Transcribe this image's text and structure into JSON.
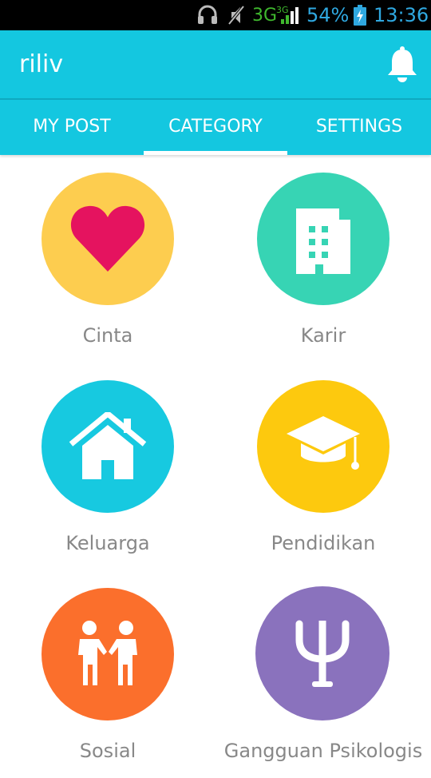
{
  "status_bar": {
    "network": "3G",
    "network_small": "3G",
    "battery_percent": "54%",
    "time": "13:36"
  },
  "app_bar": {
    "title": "riliv",
    "notification_icon": "bell-icon"
  },
  "tabs": [
    {
      "label": "MY POST",
      "active": false
    },
    {
      "label": "CATEGORY",
      "active": true
    },
    {
      "label": "SETTINGS",
      "active": false
    }
  ],
  "categories": [
    {
      "label": "Cinta",
      "icon": "heart-icon",
      "color": "#fdcd4f",
      "icon_color": "#e5135f"
    },
    {
      "label": "Karir",
      "icon": "building-icon",
      "color": "#37d4b4",
      "icon_color": "#ffffff"
    },
    {
      "label": "Keluarga",
      "icon": "house-icon",
      "color": "#17c9e0",
      "icon_color": "#ffffff"
    },
    {
      "label": "Pendidikan",
      "icon": "graduation-cap-icon",
      "color": "#fdc90e",
      "icon_color": "#ffffff"
    },
    {
      "label": "Sosial",
      "icon": "handshake-people-icon",
      "color": "#fb6f2c",
      "icon_color": "#ffffff"
    },
    {
      "label": "Gangguan Psikologis",
      "icon": "psi-icon",
      "color": "#8a72bd",
      "icon_color": "#ffffff"
    }
  ],
  "colors": {
    "primary": "#14c7e0",
    "label_text": "#888888"
  }
}
